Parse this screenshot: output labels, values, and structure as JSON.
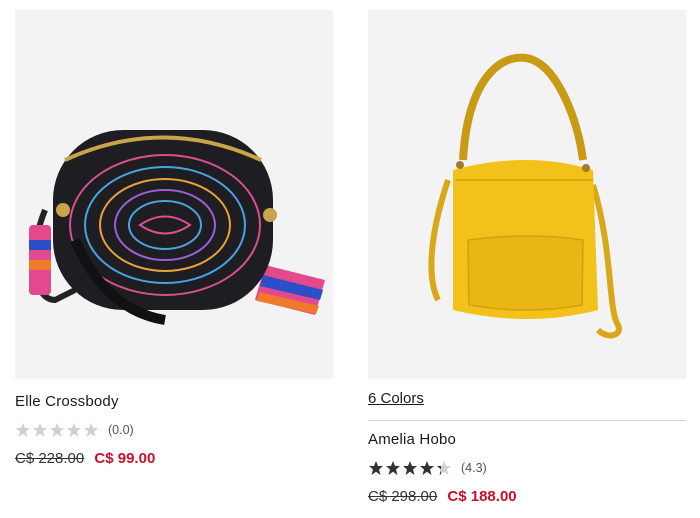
{
  "products": [
    {
      "name": "Elle Crossbody",
      "rating_value": 0,
      "rating_text": "(0.0)",
      "stars_filled": 0,
      "old_price": "C$ 228.00",
      "new_price": "C$ 99.00"
    },
    {
      "colors_label": "6 Colors",
      "name": "Amelia Hobo",
      "rating_value": 4.3,
      "rating_text": "(4.3)",
      "stars_filled": 4.3,
      "old_price": "C$ 298.00",
      "new_price": "C$ 188.00"
    }
  ],
  "colors": {
    "sale": "#c8102e",
    "star_filled": "#333333",
    "star_empty": "#d0d0d0",
    "image_bg": "#f3f3f3"
  }
}
